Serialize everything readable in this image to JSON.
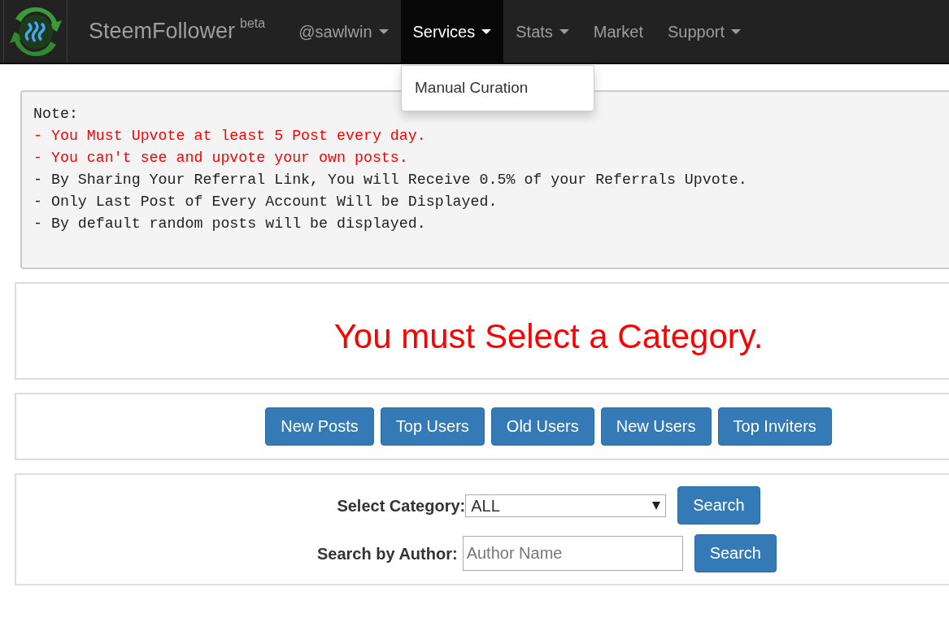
{
  "navbar": {
    "brand": "SteemFollower",
    "brand_sup": "beta",
    "items": [
      {
        "label": "@sawlwin",
        "caret": true,
        "selected": false
      },
      {
        "label": "Services",
        "caret": true,
        "selected": true
      },
      {
        "label": "Stats",
        "caret": true,
        "selected": false
      },
      {
        "label": "Market",
        "caret": false,
        "selected": false
      },
      {
        "label": "Support",
        "caret": true,
        "selected": false
      }
    ],
    "dropdown": {
      "items": [
        "Manual Curation"
      ]
    }
  },
  "note": {
    "title": "Note:",
    "lines": [
      {
        "text": "- You Must Upvote at least 5 Post every day.",
        "kind": "warning"
      },
      {
        "text": "- You can't see and upvote your own posts.",
        "kind": "warning"
      },
      {
        "text": "- By Sharing Your Referral Link, You will Receive 0.5% of your Referrals Upvote.",
        "kind": "plain"
      },
      {
        "text": "- Only Last Post of Every Account Will be Displayed.",
        "kind": "plain"
      },
      {
        "text": "- By default random posts will be displayed.",
        "kind": "plain"
      }
    ]
  },
  "message": "You must Select a Category.",
  "sort_buttons": [
    "New Posts",
    "Top Users",
    "Old Users",
    "New Users",
    "Top Inviters"
  ],
  "search": {
    "category_label": "Select Category:",
    "category_value": "ALL",
    "category_button": "Search",
    "author_label": "Search by Author:",
    "author_placeholder": "Author Name",
    "author_button": "Search"
  }
}
